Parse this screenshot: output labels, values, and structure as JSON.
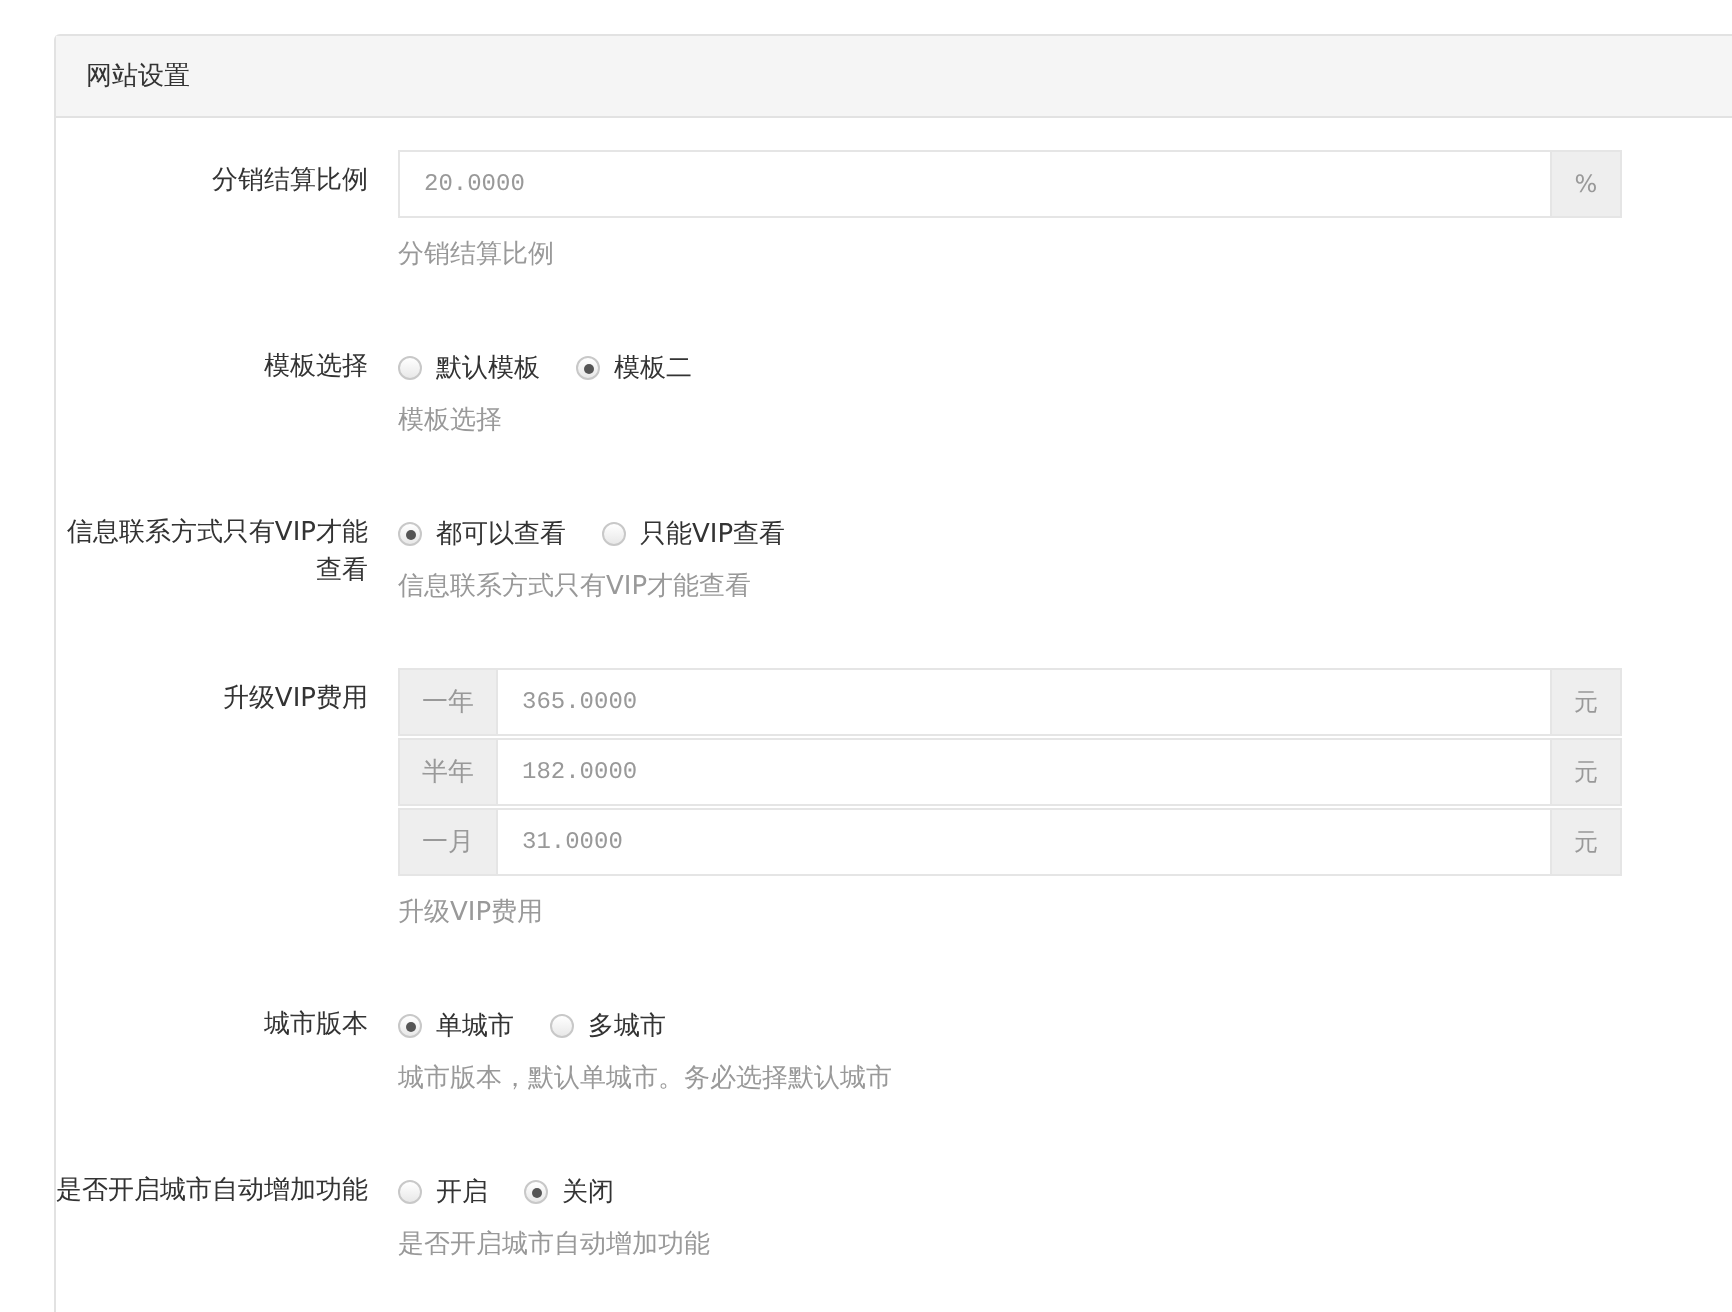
{
  "panel": {
    "title": "网站设置"
  },
  "rows": [
    {
      "kind": "input",
      "label": "分销结算比例",
      "value": "20.0000",
      "addon": "%",
      "help": "分销结算比例"
    },
    {
      "kind": "radio",
      "label": "模板选择",
      "options": [
        {
          "label": "默认模板",
          "selected": false
        },
        {
          "label": "模板二",
          "selected": true
        }
      ],
      "help": "模板选择"
    },
    {
      "kind": "radio",
      "label": "信息联系方式只有VIP才能查看",
      "options": [
        {
          "label": "都可以查看",
          "selected": true
        },
        {
          "label": "只能VIP查看",
          "selected": false
        }
      ],
      "help": "信息联系方式只有VIP才能查看"
    },
    {
      "kind": "group",
      "label": "升级VIP费用",
      "fields": [
        {
          "prefix": "一年",
          "value": "365.0000",
          "addon": "元"
        },
        {
          "prefix": "半年",
          "value": "182.0000",
          "addon": "元"
        },
        {
          "prefix": "一月",
          "value": "31.0000",
          "addon": "元"
        }
      ],
      "help": "升级VIP费用"
    },
    {
      "kind": "radio",
      "label": "城市版本",
      "options": [
        {
          "label": "单城市",
          "selected": true
        },
        {
          "label": "多城市",
          "selected": false
        }
      ],
      "help": "城市版本，默认单城市。务必选择默认城市"
    },
    {
      "kind": "radio",
      "label": "是否开启城市自动增加功能",
      "options": [
        {
          "label": "开启",
          "selected": false
        },
        {
          "label": "关闭",
          "selected": true
        }
      ],
      "help": "是否开启城市自动增加功能"
    }
  ]
}
